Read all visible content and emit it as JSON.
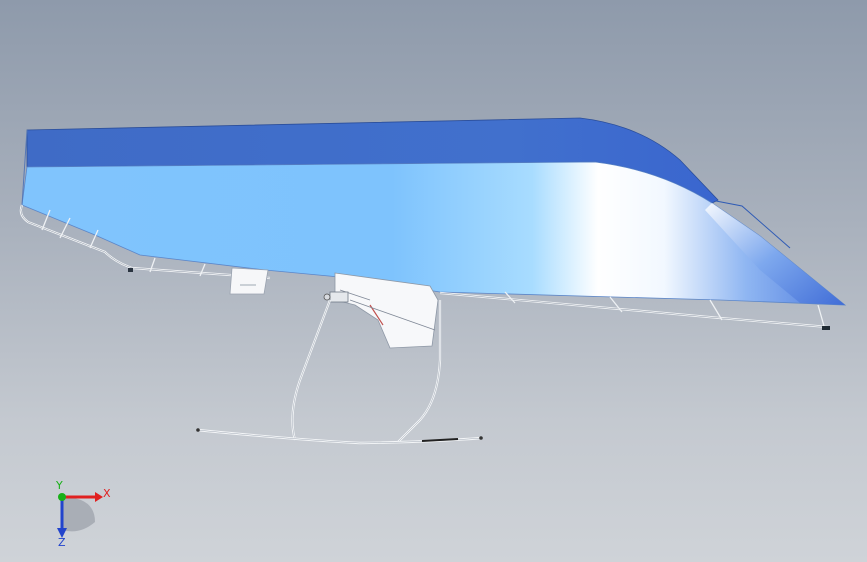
{
  "scene": {
    "model": "hull-with-hydrofoil",
    "colors": {
      "deck_top": "#3f6cc7",
      "hull_side_light": "#86c8ff",
      "hull_side_mid": "#5aa6f0",
      "highlight": "#ffffff",
      "bow_dark": "#3d6bd0",
      "rail": "#f4f6f8",
      "rail_outline": "#9aa4b2",
      "background_top": "#8e9aab",
      "background_bottom": "#cfd3d8"
    }
  },
  "triad": {
    "x_label": "X",
    "y_label": "Y",
    "z_label": "Z",
    "x_color": "#e02020",
    "y_color": "#18b018",
    "z_color": "#2244cc"
  }
}
